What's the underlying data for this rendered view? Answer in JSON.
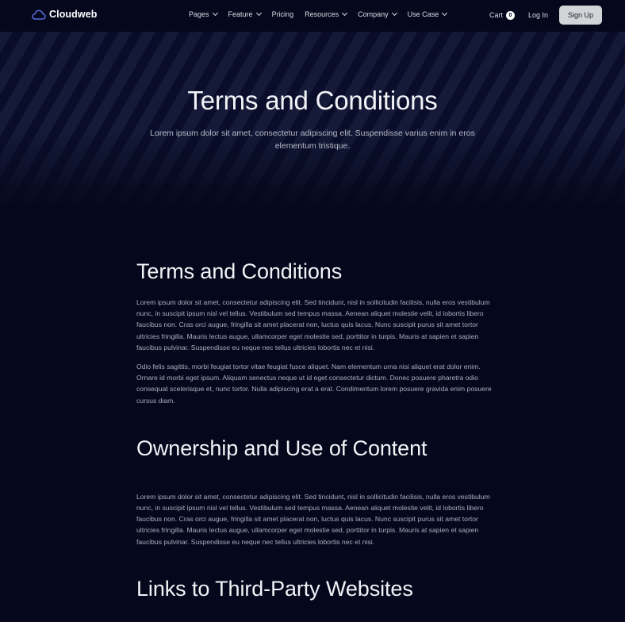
{
  "brand": {
    "name": "Cloudweb",
    "icon": "cloud-icon",
    "accent": "#5b6ee1"
  },
  "nav": {
    "items": [
      {
        "label": "Pages",
        "has_dropdown": true
      },
      {
        "label": "Feature",
        "has_dropdown": true
      },
      {
        "label": "Pricing",
        "has_dropdown": false
      },
      {
        "label": "Resources",
        "has_dropdown": true
      },
      {
        "label": "Company",
        "has_dropdown": true
      },
      {
        "label": "Use Case",
        "has_dropdown": true
      }
    ],
    "cart_label": "Cart",
    "cart_count": "0",
    "login_label": "Log In",
    "signup_label": "Sign Up"
  },
  "hero": {
    "title": "Terms and Conditions",
    "subtitle": "Lorem ipsum dolor sit amet, consectetur adipiscing elit. Suspendisse varius enim in eros elementum tristique."
  },
  "sections": [
    {
      "title": "Terms and Conditions",
      "paragraphs": [
        "Lorem ipsum dolor sit amet, consectetur adipiscing elit. Sed tincidunt, nisl in sollicitudin facilisis, nulla eros vestibulum nunc, in suscipit ipsum nisl vel tellus. Vestibulum sed tempus massa. Aenean aliquet molestie velit, id lobortis libero faucibus non. Cras orci augue, fringilla sit amet placerat non, luctus quis lacus. Nunc suscipit purus sit amet tortor ultricies fringilla. Mauris lectus augue, ullamcorper eget molestie sed, porttitor in turpis. Mauris at sapien et sapien faucibus pulvinar. Suspendisse eu neque nec tellus ultricies lobortis nec et nisi.",
        "Odio felis sagittis, morbi feugiat tortor vitae feugiat fusce aliquet. Nam elementum urna nisi aliquet erat dolor enim. Ornare id morbi eget ipsum. Aliquam senectus neque ut id eget consectetur dictum. Donec posuere pharetra odio consequat scelerisque et, nunc tortor. Nulla adipiscing erat a erat. Condimentum lorem posuere gravida enim posuere cursus diam."
      ]
    },
    {
      "title": "Ownership and Use of Content",
      "paragraphs": [
        "Lorem ipsum dolor sit amet, consectetur adipiscing elit. Sed tincidunt, nisl in sollicitudin facilisis, nulla eros vestibulum nunc, in suscipit ipsum nisl vel tellus. Vestibulum sed tempus massa. Aenean aliquet molestie velit, id lobortis libero faucibus non. Cras orci augue, fringilla sit amet placerat non, luctus quis lacus. Nunc suscipit purus sit amet tortor ultricies fringilla. Mauris lectus augue, ullamcorper eget molestie sed, porttitor in turpis. Mauris at sapien et sapien faucibus pulvinar. Suspendisse eu neque nec tellus ultricies lobortis nec et nisi."
      ]
    },
    {
      "title": "Links to Third-Party Websites",
      "paragraphs": []
    }
  ]
}
